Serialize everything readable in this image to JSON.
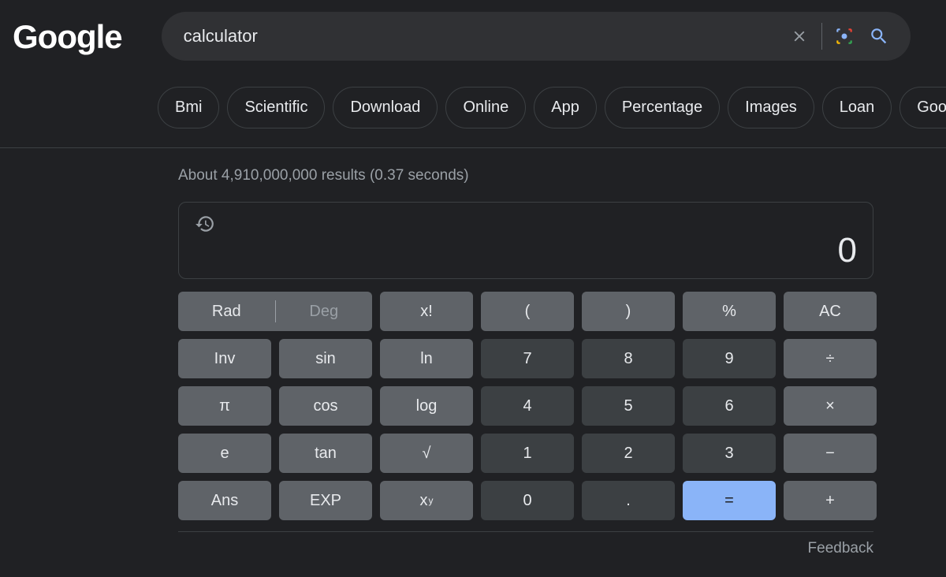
{
  "logo": "Google",
  "search": {
    "value": "calculator"
  },
  "chips": [
    "Bmi",
    "Scientific",
    "Download",
    "Online",
    "App",
    "Percentage",
    "Images",
    "Loan",
    "Google"
  ],
  "result_stats": "About 4,910,000,000 results (0.37 seconds)",
  "calc": {
    "display": "0",
    "angle": {
      "rad": "Rad",
      "deg": "Deg",
      "active": "rad"
    },
    "keys": {
      "factorial": "x!",
      "lparen": "(",
      "rparen": ")",
      "percent": "%",
      "ac": "AC",
      "inv": "Inv",
      "sin": "sin",
      "ln": "ln",
      "n7": "7",
      "n8": "8",
      "n9": "9",
      "div": "÷",
      "pi": "π",
      "cos": "cos",
      "log": "log",
      "n4": "4",
      "n5": "5",
      "n6": "6",
      "mul": "×",
      "e": "e",
      "tan": "tan",
      "sqrt": "√",
      "n1": "1",
      "n2": "2",
      "n3": "3",
      "sub": "−",
      "ans": "Ans",
      "exp": "EXP",
      "pow_base": "x",
      "pow_exp": "y",
      "n0": "0",
      "dot": ".",
      "eq": "=",
      "add": "+"
    }
  },
  "feedback": "Feedback"
}
